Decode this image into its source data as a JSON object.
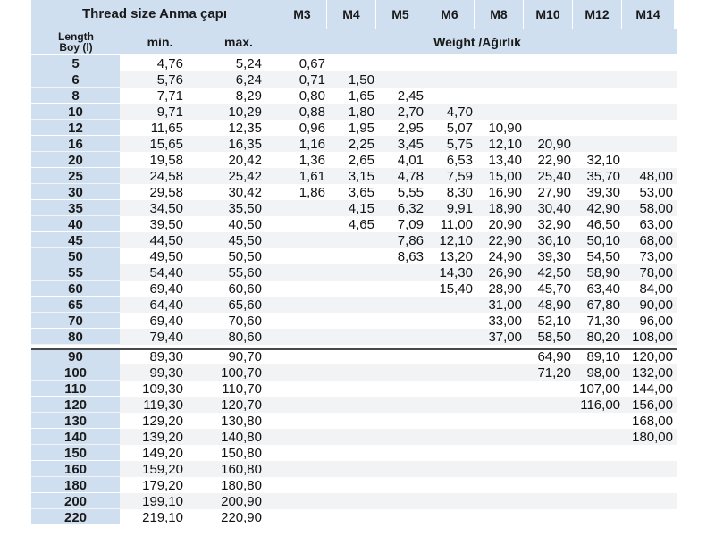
{
  "header": {
    "thread_size_label": "Thread size Anma çapı",
    "sizes": [
      "M3",
      "M4",
      "M5",
      "M6",
      "M8",
      "M10",
      "M12",
      "M14"
    ],
    "length_label_line1": "Length",
    "length_label_line2": "Boy (l)",
    "min_label": "min.",
    "max_label": "max.",
    "weight_label": "Weight /Ağırlık"
  },
  "rows": [
    {
      "length": "5",
      "min": "4,76",
      "max": "5,24",
      "weights": [
        "0,67",
        "",
        "",
        "",
        "",
        "",
        "",
        ""
      ]
    },
    {
      "length": "6",
      "min": "5,76",
      "max": "6,24",
      "weights": [
        "0,71",
        "1,50",
        "",
        "",
        "",
        "",
        "",
        ""
      ]
    },
    {
      "length": "8",
      "min": "7,71",
      "max": "8,29",
      "weights": [
        "0,80",
        "1,65",
        "2,45",
        "",
        "",
        "",
        "",
        ""
      ]
    },
    {
      "length": "10",
      "min": "9,71",
      "max": "10,29",
      "weights": [
        "0,88",
        "1,80",
        "2,70",
        "4,70",
        "",
        "",
        "",
        ""
      ]
    },
    {
      "length": "12",
      "min": "11,65",
      "max": "12,35",
      "weights": [
        "0,96",
        "1,95",
        "2,95",
        "5,07",
        "10,90",
        "",
        "",
        ""
      ]
    },
    {
      "length": "16",
      "min": "15,65",
      "max": "16,35",
      "weights": [
        "1,16",
        "2,25",
        "3,45",
        "5,75",
        "12,10",
        "20,90",
        "",
        ""
      ]
    },
    {
      "length": "20",
      "min": "19,58",
      "max": "20,42",
      "weights": [
        "1,36",
        "2,65",
        "4,01",
        "6,53",
        "13,40",
        "22,90",
        "32,10",
        ""
      ]
    },
    {
      "length": "25",
      "min": "24,58",
      "max": "25,42",
      "weights": [
        "1,61",
        "3,15",
        "4,78",
        "7,59",
        "15,00",
        "25,40",
        "35,70",
        "48,00"
      ]
    },
    {
      "length": "30",
      "min": "29,58",
      "max": "30,42",
      "weights": [
        "1,86",
        "3,65",
        "5,55",
        "8,30",
        "16,90",
        "27,90",
        "39,30",
        "53,00"
      ]
    },
    {
      "length": "35",
      "min": "34,50",
      "max": "35,50",
      "weights": [
        "",
        "4,15",
        "6,32",
        "9,91",
        "18,90",
        "30,40",
        "42,90",
        "58,00"
      ]
    },
    {
      "length": "40",
      "min": "39,50",
      "max": "40,50",
      "weights": [
        "",
        "4,65",
        "7,09",
        "11,00",
        "20,90",
        "32,90",
        "46,50",
        "63,00"
      ]
    },
    {
      "length": "45",
      "min": "44,50",
      "max": "45,50",
      "weights": [
        "",
        "",
        "7,86",
        "12,10",
        "22,90",
        "36,10",
        "50,10",
        "68,00"
      ]
    },
    {
      "length": "50",
      "min": "49,50",
      "max": "50,50",
      "weights": [
        "",
        "",
        "8,63",
        "13,20",
        "24,90",
        "39,30",
        "54,50",
        "73,00"
      ]
    },
    {
      "length": "55",
      "min": "54,40",
      "max": "55,60",
      "weights": [
        "",
        "",
        "",
        "14,30",
        "26,90",
        "42,50",
        "58,90",
        "78,00"
      ]
    },
    {
      "length": "60",
      "min": "69,40",
      "max": "60,60",
      "weights": [
        "",
        "",
        "",
        "15,40",
        "28,90",
        "45,70",
        "63,40",
        "84,00"
      ]
    },
    {
      "length": "65",
      "min": "64,40",
      "max": "65,60",
      "weights": [
        "",
        "",
        "",
        "",
        "31,00",
        "48,90",
        "67,80",
        "90,00"
      ]
    },
    {
      "length": "70",
      "min": "69,40",
      "max": "70,60",
      "weights": [
        "",
        "",
        "",
        "",
        "33,00",
        "52,10",
        "71,30",
        "96,00"
      ]
    },
    {
      "length": "80",
      "min": "79,40",
      "max": "80,60",
      "weights": [
        "",
        "",
        "",
        "",
        "37,00",
        "58,50",
        "80,20",
        "108,00"
      ]
    },
    {
      "length": "90",
      "min": "89,30",
      "max": "90,70",
      "weights": [
        "",
        "",
        "",
        "",
        "",
        "64,90",
        "89,10",
        "120,00"
      ]
    },
    {
      "length": "100",
      "min": "99,30",
      "max": "100,70",
      "weights": [
        "",
        "",
        "",
        "",
        "",
        "71,20",
        "98,00",
        "132,00"
      ]
    },
    {
      "length": "110",
      "min": "109,30",
      "max": "110,70",
      "weights": [
        "",
        "",
        "",
        "",
        "",
        "",
        "107,00",
        "144,00"
      ]
    },
    {
      "length": "120",
      "min": "119,30",
      "max": "120,70",
      "weights": [
        "",
        "",
        "",
        "",
        "",
        "",
        "116,00",
        "156,00"
      ]
    },
    {
      "length": "130",
      "min": "129,20",
      "max": "130,80",
      "weights": [
        "",
        "",
        "",
        "",
        "",
        "",
        "",
        "168,00"
      ]
    },
    {
      "length": "140",
      "min": "139,20",
      "max": "140,80",
      "weights": [
        "",
        "",
        "",
        "",
        "",
        "",
        "",
        "180,00"
      ]
    },
    {
      "length": "150",
      "min": "149,20",
      "max": "150,80",
      "weights": [
        "",
        "",
        "",
        "",
        "",
        "",
        "",
        ""
      ]
    },
    {
      "length": "160",
      "min": "159,20",
      "max": "160,80",
      "weights": [
        "",
        "",
        "",
        "",
        "",
        "",
        "",
        ""
      ]
    },
    {
      "length": "180",
      "min": "179,20",
      "max": "180,80",
      "weights": [
        "",
        "",
        "",
        "",
        "",
        "",
        "",
        ""
      ]
    },
    {
      "length": "200",
      "min": "199,10",
      "max": "200,90",
      "weights": [
        "",
        "",
        "",
        "",
        "",
        "",
        "",
        ""
      ]
    },
    {
      "length": "220",
      "min": "219,10",
      "max": "220,90",
      "weights": [
        "",
        "",
        "",
        "",
        "",
        "",
        "",
        ""
      ]
    }
  ]
}
